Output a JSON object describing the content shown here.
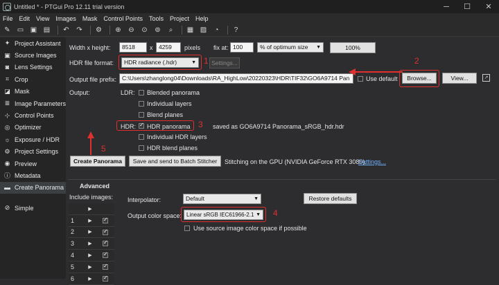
{
  "window": {
    "title": "Untitled * - PTGui Pro 12.11 trial version"
  },
  "menu": [
    "File",
    "Edit",
    "View",
    "Images",
    "Mask",
    "Control Points",
    "Tools",
    "Project",
    "Help"
  ],
  "sidebar": {
    "items": [
      {
        "label": "Project Assistant",
        "icon": "wand-icon"
      },
      {
        "label": "Source Images",
        "icon": "images-icon"
      },
      {
        "label": "Lens Settings",
        "icon": "camera-icon"
      },
      {
        "label": "Crop",
        "icon": "crop-icon"
      },
      {
        "label": "Mask",
        "icon": "mask-icon"
      },
      {
        "label": "Image Parameters",
        "icon": "sliders-icon"
      },
      {
        "label": "Control Points",
        "icon": "points-icon"
      },
      {
        "label": "Optimizer",
        "icon": "optimizer-icon"
      },
      {
        "label": "Exposure / HDR",
        "icon": "exposure-icon"
      },
      {
        "label": "Project Settings",
        "icon": "gear-icon"
      },
      {
        "label": "Preview",
        "icon": "eye-icon"
      },
      {
        "label": "Metadata",
        "icon": "info-icon"
      },
      {
        "label": "Create Panorama",
        "icon": "panorama-icon"
      }
    ],
    "simple": "Simple"
  },
  "size": {
    "label": "Width x height:",
    "width": "8518",
    "x": "x",
    "height": "4259",
    "pixels": "pixels",
    "fix_at": "fix at:",
    "fix_value": "100",
    "percent_option": "% of optimum size",
    "hundred_btn": "100%"
  },
  "format": {
    "label": "HDR file format:",
    "value": "HDR radiance (.hdr)",
    "settings_btn": "Settings..."
  },
  "output": {
    "prefix_label": "Output file prefix:",
    "prefix_value": "C:\\Users\\zhanglong04\\Downloads\\RA_HighLow\\20220323\\HDR\\TIF32\\GO6A9714 Pan",
    "use_default": "Use default",
    "browse_btn": "Browse...",
    "view_btn": "View..."
  },
  "outputs": {
    "label": "Output:",
    "ldr": "LDR:",
    "ldr_items": [
      "Blended panorama",
      "Individual layers",
      "Blend planes"
    ],
    "hdr": "HDR:",
    "hdr_items": [
      "HDR panorama",
      "Individual HDR layers",
      "HDR blend planes"
    ],
    "saved_as": "saved as GO6A9714 Panorama_sRGB_hdr.hdr"
  },
  "actions": {
    "create_btn": "Create Panorama",
    "batch_btn": "Save and send to Batch Stitcher",
    "gpu_text": "Stitching on the GPU (NVIDIA GeForce RTX 3080).",
    "settings_link": "Settings..."
  },
  "advanced": {
    "title": "Advanced",
    "include_label": "Include images:",
    "interpolator_label": "Interpolator:",
    "interpolator_value": "Default",
    "restore_btn": "Restore defaults",
    "colorspace_label": "Output color space:",
    "colorspace_value": "Linear sRGB IEC61966-2.1",
    "use_source": "Use source image color space if possible"
  },
  "rows": [
    "1",
    "2",
    "3",
    "4",
    "5",
    "6"
  ],
  "annotations": [
    "1",
    "2",
    "3",
    "4",
    "5"
  ],
  "colors": {
    "annotation": "#e03030",
    "background": "#2d2d30",
    "sidebar": "#252526"
  }
}
